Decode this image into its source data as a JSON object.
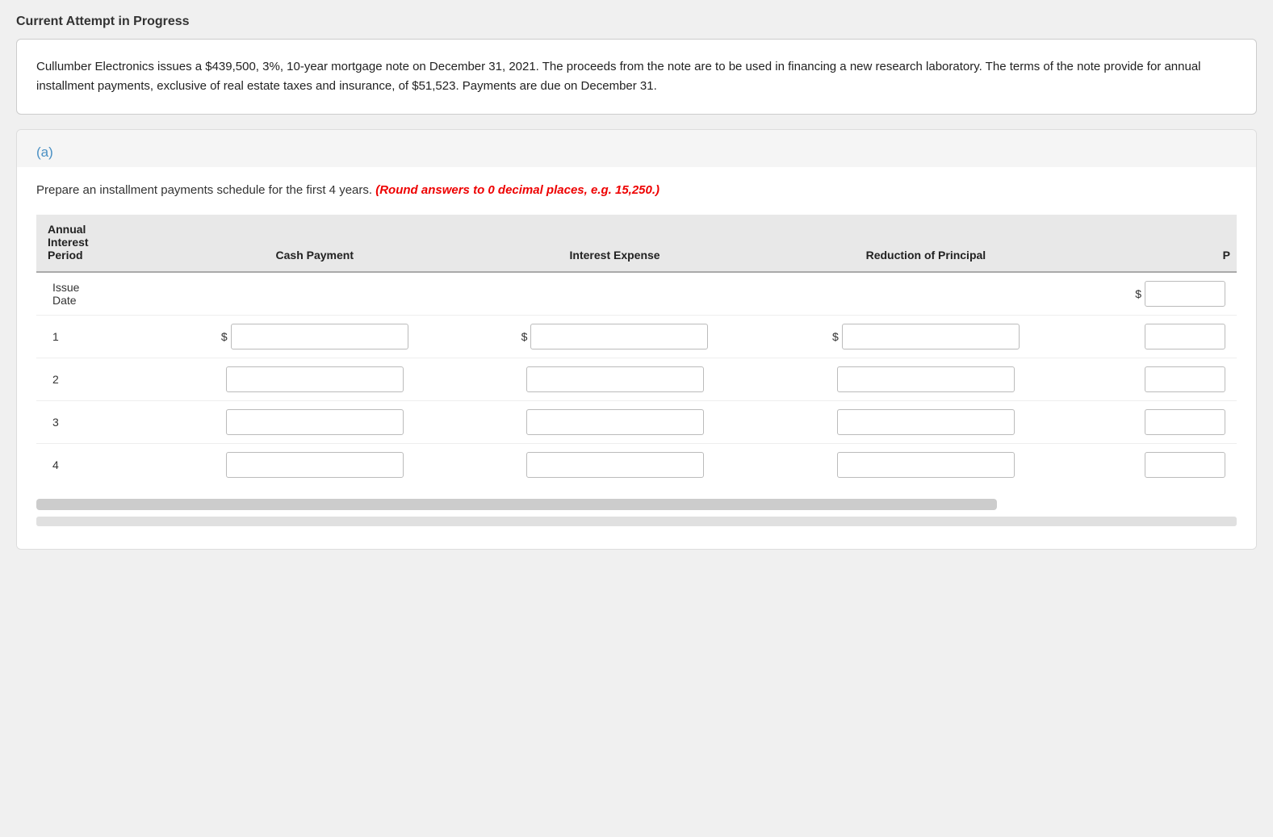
{
  "header": {
    "title": "Current Attempt in Progress"
  },
  "problem": {
    "text": "Cullumber Electronics issues a $439,500, 3%, 10-year mortgage note on December 31, 2021. The proceeds from the note are to be used in financing a new research laboratory. The terms of the note provide for annual installment payments, exclusive of real estate taxes and insurance, of $51,523. Payments are due on December 31."
  },
  "section_a": {
    "label": "(a)",
    "instructions_plain": "Prepare an installment payments schedule for the first 4 years.",
    "instructions_highlight": "(Round answers to 0 decimal places, e.g. 15,250.)",
    "table": {
      "headers": {
        "period": "Annual\nInterest\nPeriod",
        "cash_payment": "Cash Payment",
        "interest_expense": "Interest Expense",
        "reduction": "Reduction of Principal",
        "principal": "P"
      },
      "rows": [
        {
          "period": "Issue\nDate",
          "show_dollar_cash": false,
          "show_dollar_interest": false,
          "show_dollar_reduction": false,
          "show_dollar_principal": true,
          "input_cash": false,
          "input_interest": false,
          "input_reduction": false,
          "input_principal": true
        },
        {
          "period": "1",
          "show_dollar_cash": true,
          "show_dollar_interest": true,
          "show_dollar_reduction": true,
          "show_dollar_principal": false,
          "input_cash": true,
          "input_interest": true,
          "input_reduction": true,
          "input_principal": true
        },
        {
          "period": "2",
          "show_dollar_cash": false,
          "show_dollar_interest": false,
          "show_dollar_reduction": false,
          "show_dollar_principal": false,
          "input_cash": true,
          "input_interest": true,
          "input_reduction": true,
          "input_principal": true
        },
        {
          "period": "3",
          "show_dollar_cash": false,
          "show_dollar_interest": false,
          "show_dollar_reduction": false,
          "show_dollar_principal": false,
          "input_cash": true,
          "input_interest": true,
          "input_reduction": true,
          "input_principal": true
        },
        {
          "period": "4",
          "show_dollar_cash": false,
          "show_dollar_interest": false,
          "show_dollar_reduction": false,
          "show_dollar_principal": false,
          "input_cash": true,
          "input_interest": true,
          "input_reduction": true,
          "input_principal": true
        }
      ]
    }
  }
}
